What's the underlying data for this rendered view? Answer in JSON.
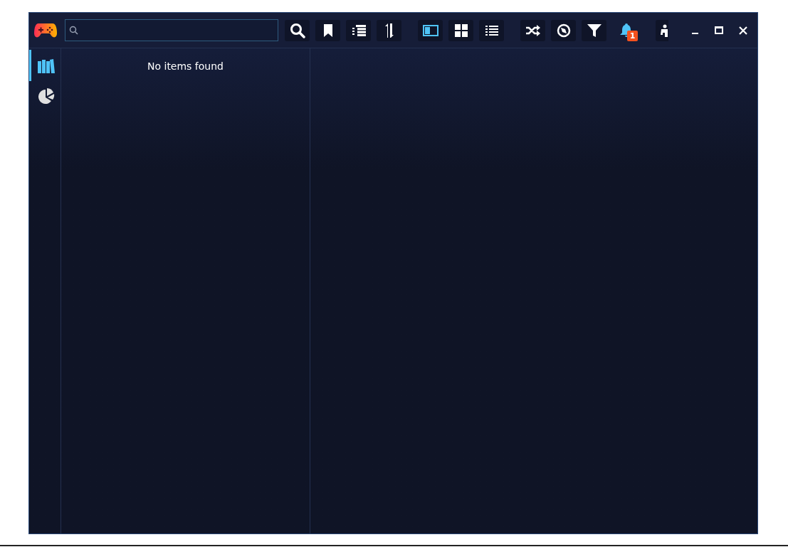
{
  "sidebar": {
    "items": [
      {
        "selected": true
      },
      {
        "selected": false
      }
    ]
  },
  "view_modes": [
    {
      "selected": true
    },
    {
      "selected": false
    },
    {
      "selected": false
    }
  ],
  "notifications": {
    "badge": "1"
  },
  "list_panel": {
    "message": "No items found"
  }
}
